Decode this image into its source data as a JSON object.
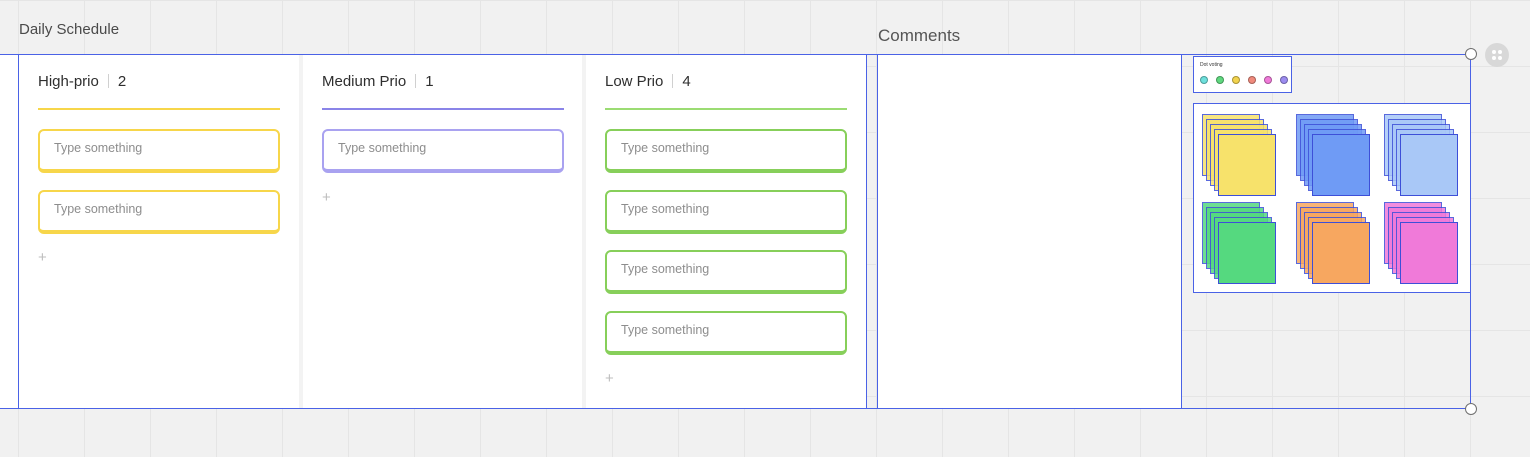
{
  "frames": {
    "daily_schedule_title": "Daily Schedule",
    "comments_title": "Comments"
  },
  "columns": [
    {
      "title": "High-prio",
      "count": "2",
      "accent": "#f7d64a",
      "cards": [
        "Type something",
        "Type something"
      ]
    },
    {
      "title": "Medium Prio",
      "count": "1",
      "accent": "#8a84e8",
      "cards": [
        "Type something"
      ]
    },
    {
      "title": "Low Prio",
      "count": "4",
      "accent": "#87cf5a",
      "cards": [
        "Type something",
        "Type something",
        "Type something",
        "Type something"
      ]
    }
  ],
  "add_icon": "+",
  "dot_voting": {
    "title": "Dot voting",
    "dot_colors": [
      "#6ee0dc",
      "#5fd87f",
      "#f2d34d",
      "#f08a7c",
      "#f07ad9",
      "#9c8cf0"
    ]
  },
  "sticky_colors": [
    "#f7e26b",
    "#6f9bf5",
    "#a9c8f7",
    "#55d97f",
    "#f7a760",
    "#f07ad9"
  ],
  "icons": {
    "more": "more-icon",
    "resize_handle": "resize-handle-icon",
    "add": "plus-icon"
  }
}
